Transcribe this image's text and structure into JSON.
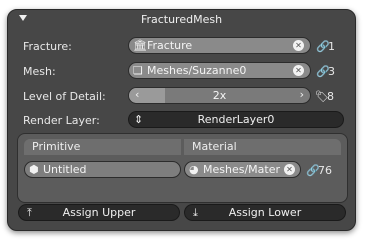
{
  "panel": {
    "title": "FracturedMesh",
    "collapse_icon": "triangle-down-icon"
  },
  "fracture": {
    "label": "Fracture:",
    "value": "Fracture",
    "icon": "bank-icon",
    "users_icon": "link-icon",
    "users": "1"
  },
  "mesh": {
    "label": "Mesh:",
    "value": "Meshes/Suzanne0",
    "icon": "mesh-icon",
    "users_icon": "link-icon",
    "users": "3"
  },
  "lod": {
    "label": "Level of Detail:",
    "value": "2x",
    "fill_fraction": 0.2,
    "tag_icon": "tag-icon",
    "count": "8"
  },
  "render_layer": {
    "label": "Render Layer:",
    "value": "RenderLayer0",
    "icon": "updown-icon"
  },
  "table": {
    "col_primitive": "Primitive",
    "col_material": "Material",
    "primitive_value": "Untitled",
    "primitive_icon": "shield-icon",
    "material_value": "Meshes/Materi",
    "material_icon": "material-icon",
    "material_users": "76"
  },
  "actions": {
    "assign_upper": "Assign Upper",
    "assign_lower": "Assign Lower"
  },
  "colors": {
    "panel_bg": "#474747",
    "field_bg": "#8a8a8a",
    "button_bg": "#2a2a2a"
  }
}
